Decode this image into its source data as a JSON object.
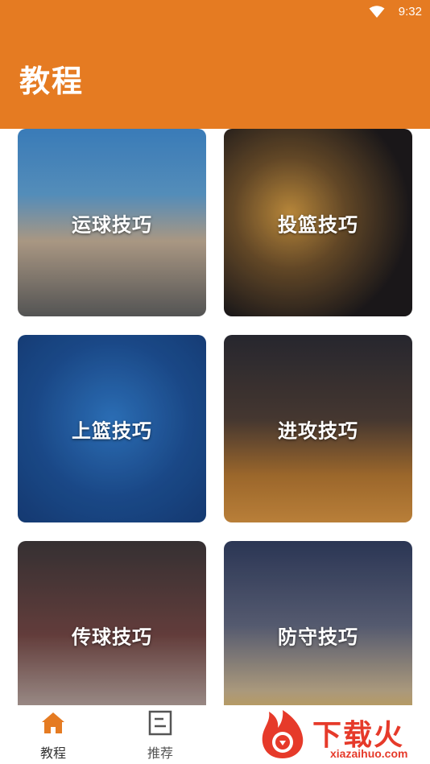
{
  "status_bar": {
    "time": "9:32"
  },
  "header": {
    "title": "教程"
  },
  "cards": [
    {
      "label": "运球技巧"
    },
    {
      "label": "投篮技巧"
    },
    {
      "label": "上篮技巧"
    },
    {
      "label": "进攻技巧"
    },
    {
      "label": "传球技巧"
    },
    {
      "label": "防守技巧"
    }
  ],
  "tab_bar": {
    "tabs": [
      {
        "label": "教程",
        "active": true
      },
      {
        "label": "推荐",
        "active": false
      }
    ]
  },
  "watermark": {
    "brand": "下载火",
    "url": "xiazaihuo.com"
  },
  "colors": {
    "brand": "#e57b22",
    "watermark": "#e63a2a"
  }
}
